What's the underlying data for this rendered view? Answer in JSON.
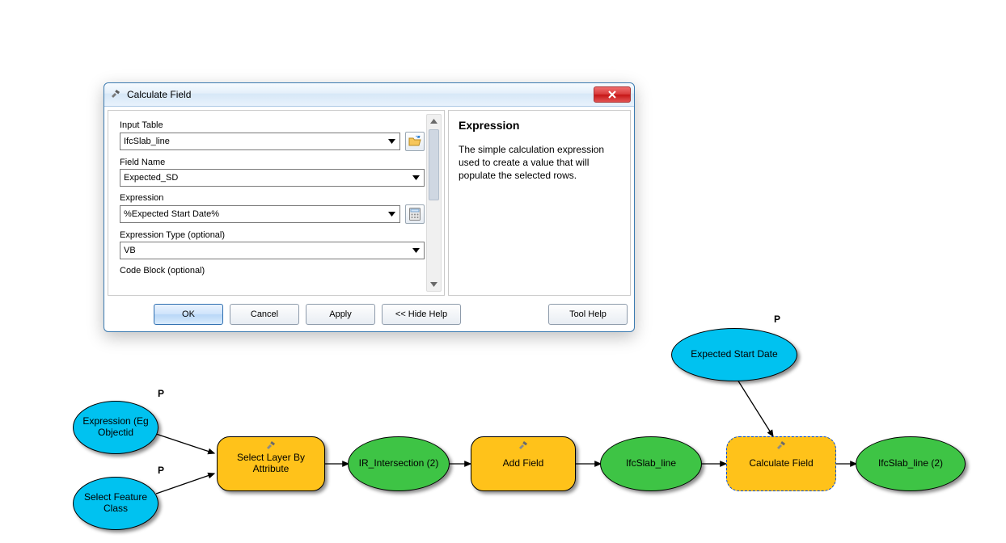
{
  "dialog": {
    "title": "Calculate Field",
    "fields": {
      "input_table": {
        "label": "Input Table",
        "value": "IfcSlab_line"
      },
      "field_name": {
        "label": "Field Name",
        "value": "Expected_SD"
      },
      "expression": {
        "label": "Expression",
        "value": "%Expected Start Date%"
      },
      "expr_type": {
        "label": "Expression Type (optional)",
        "value": "VB"
      },
      "code_block": {
        "label": "Code Block (optional)",
        "value": ""
      }
    },
    "buttons": {
      "ok": "OK",
      "cancel": "Cancel",
      "apply": "Apply",
      "hide_help": "<< Hide Help",
      "tool_help": "Tool Help"
    },
    "help": {
      "title": "Expression",
      "body": "The simple calculation expression used to create a value that will populate the selected rows."
    }
  },
  "model": {
    "nodes": {
      "expression_param": "Expression (Eg Objectid",
      "select_feature": "Select Feature Class",
      "expected_start": "Expected Start Date",
      "select_layer_tool": "Select Layer By Attribute",
      "ir_intersection": "IR_Intersection (2)",
      "add_field_tool": "Add Field",
      "ifcslab_line": "IfcSlab_line",
      "calculate_field": "Calculate Field",
      "ifcslab_line_2": "IfcSlab_line (2)"
    },
    "p_label": "P"
  }
}
